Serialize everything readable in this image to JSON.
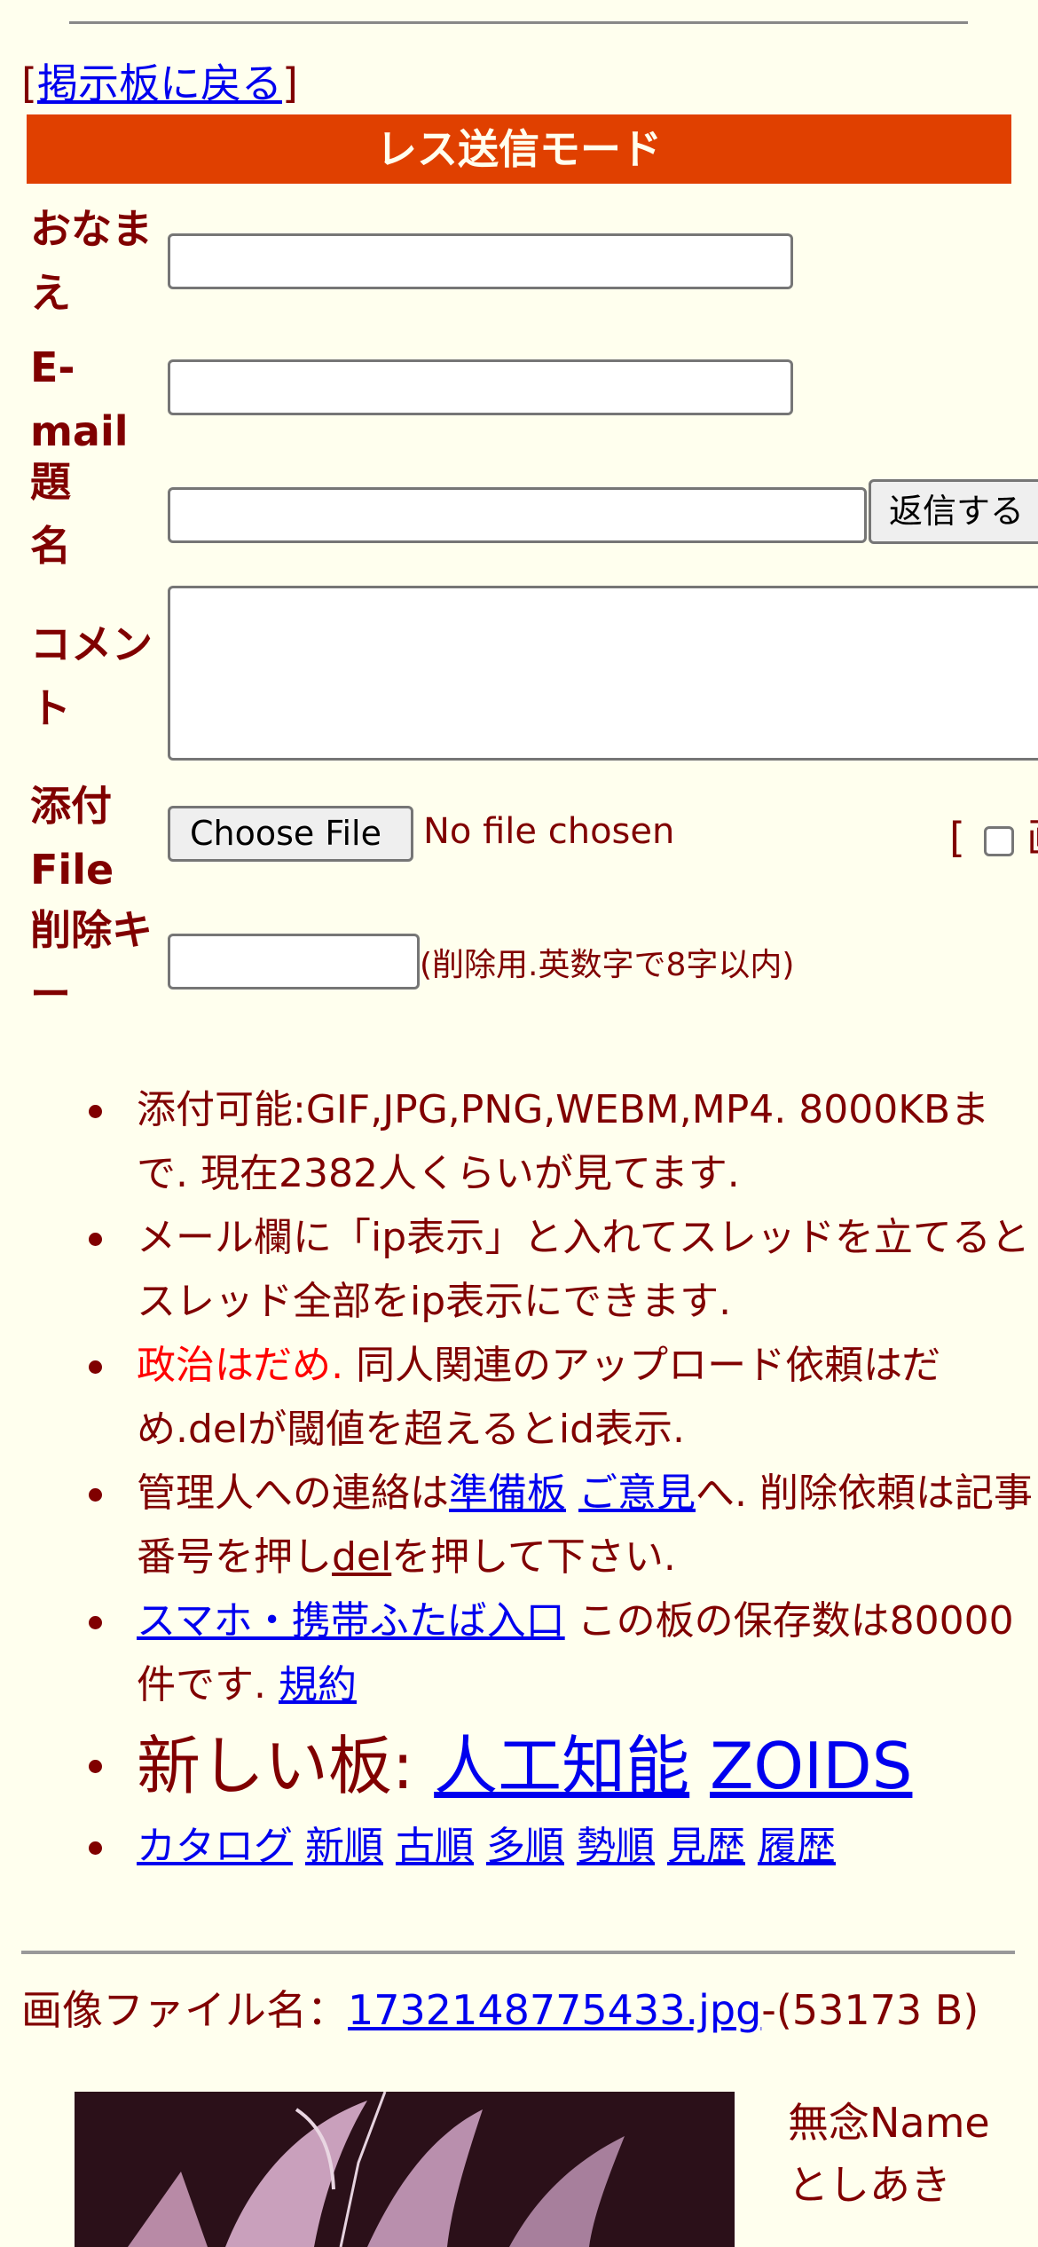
{
  "nav": {
    "back_open": "[",
    "back_label": "掲示板に戻る",
    "back_close": "]"
  },
  "mode_title": "レス送信モード",
  "form": {
    "name_label_1": "おなま",
    "name_label_2": "え",
    "email_label_1": "E-",
    "email_label_2": "mail",
    "subject_label_1": "題",
    "subject_label_2": "名",
    "submit_label": "返信する",
    "comment_label_1": "コメン",
    "comment_label_2": "ト",
    "attach_label_1": "添付",
    "attach_label_2": "File",
    "choose_file": "Choose File",
    "no_file": "No file chosen",
    "image_opt_bracket": "[",
    "image_opt_text": "画",
    "delkey_label_1": "削除キ",
    "delkey_label_2": "ー",
    "delkey_note": "(削除用.英数字で8字以内)"
  },
  "rules": {
    "r1": "添付可能:GIF,JPG,PNG,WEBM,MP4. 8000KBまで. 現在2382人くらいが見てます.",
    "r2": "メール欄に「ip表示」と入れてスレッドを立てるとスレッド全部をip表示にできます.",
    "r3_red": "政治はだめ.",
    "r3_rest": " 同人関連のアップロード依頼はだめ.delが閾値を超えるとid表示.",
    "r4_pre": "管理人への連絡は",
    "r4_link1": "準備板",
    "r4_sep": " ",
    "r4_link2": "ご意見",
    "r4_mid": "へ. 削除依頼は記事番号を押し",
    "r4_link3": "del",
    "r4_post": "を押して下さい.",
    "r5_link": "スマホ・携帯ふたば入口",
    "r5_mid": " この板の保存数は80000件です. ",
    "r5_link2": "規約",
    "r6_pre": "新しい板: ",
    "r6_link1": "人工知能",
    "r6_sep": " ",
    "r6_link2": "ZOIDS",
    "r7": [
      "カタログ",
      "新順",
      "古順",
      "多順",
      "勢順",
      "見歴",
      "履歴"
    ]
  },
  "post": {
    "fileinfo_pre": "画像ファイル名：",
    "file_link": "1732148775433.jpg",
    "file_size": "-(53173 B)",
    "name": "無念Name",
    "poster": "としあき"
  }
}
